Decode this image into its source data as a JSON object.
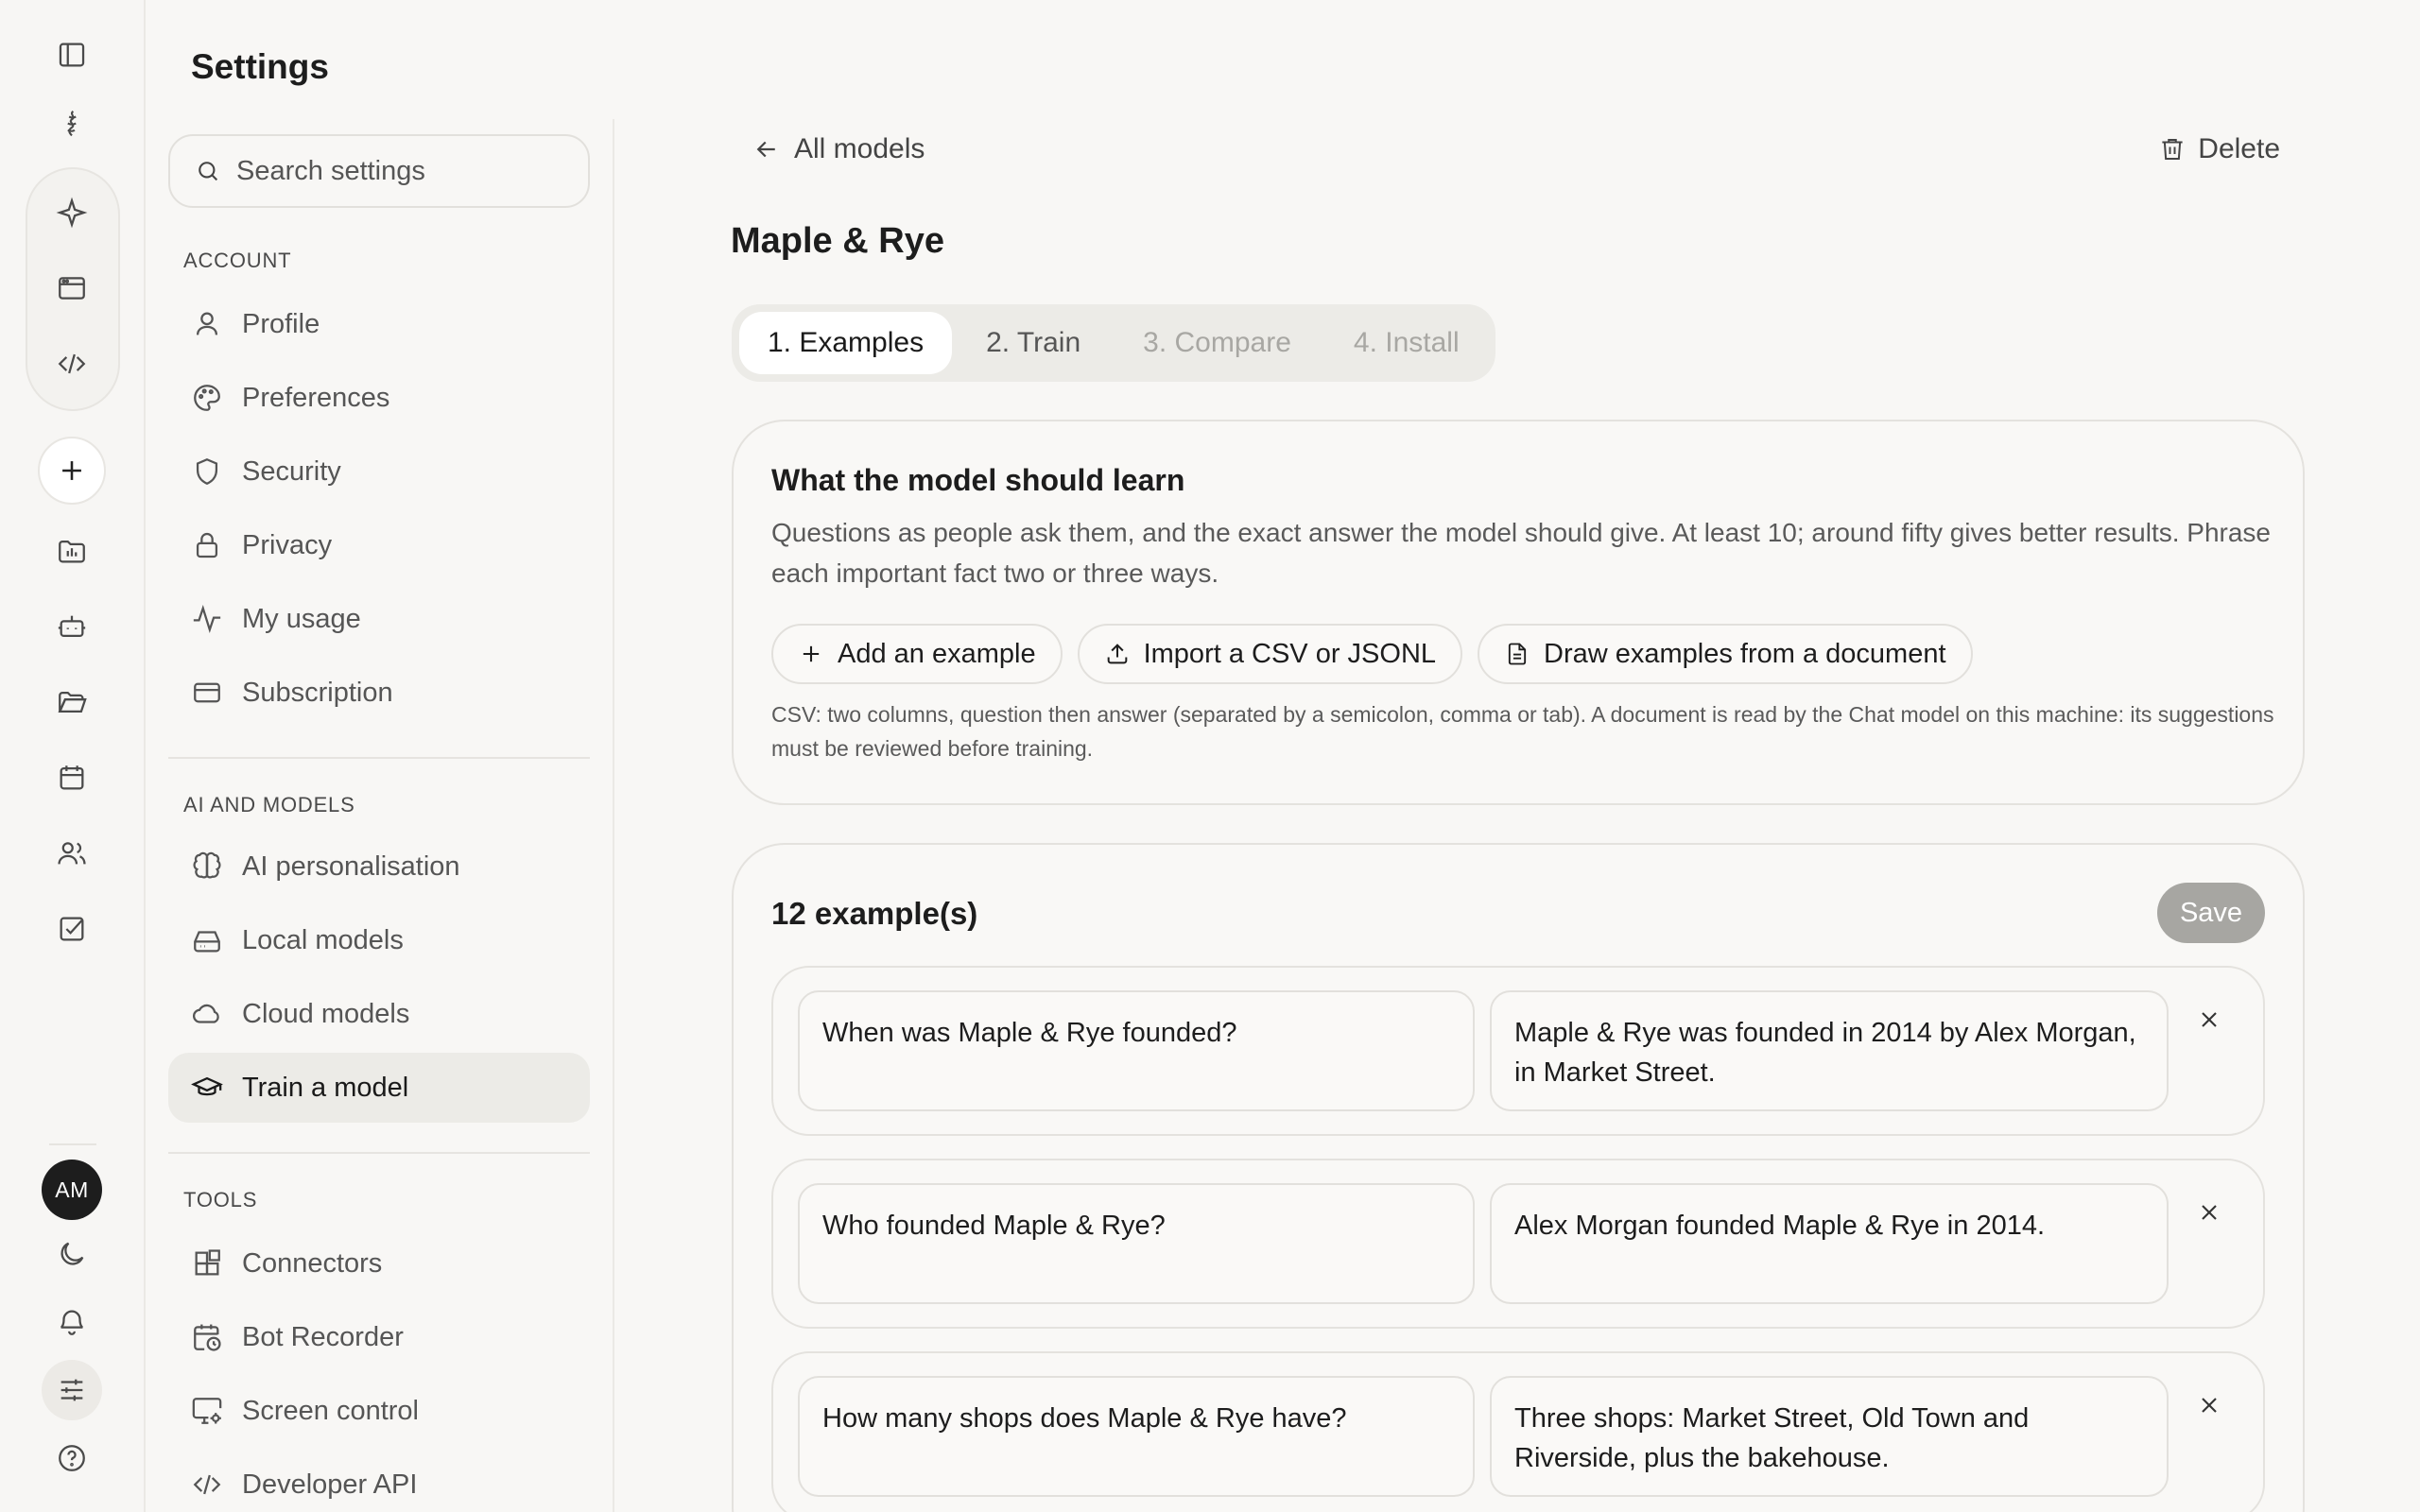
{
  "rail": {
    "avatar_initials": "AM"
  },
  "settings": {
    "title": "Settings",
    "search_placeholder": "Search settings",
    "sections": [
      {
        "label": "ACCOUNT",
        "items": [
          {
            "label": "Profile",
            "icon": "user-icon"
          },
          {
            "label": "Preferences",
            "icon": "palette-icon"
          },
          {
            "label": "Security",
            "icon": "shield-icon"
          },
          {
            "label": "Privacy",
            "icon": "lock-icon"
          },
          {
            "label": "My usage",
            "icon": "activity-icon"
          },
          {
            "label": "Subscription",
            "icon": "credit-card-icon"
          }
        ]
      },
      {
        "label": "AI AND MODELS",
        "items": [
          {
            "label": "AI personalisation",
            "icon": "brain-icon"
          },
          {
            "label": "Local models",
            "icon": "hard-drive-icon"
          },
          {
            "label": "Cloud models",
            "icon": "cloud-icon"
          },
          {
            "label": "Train a model",
            "icon": "graduation-cap-icon",
            "active": true
          }
        ]
      },
      {
        "label": "TOOLS",
        "items": [
          {
            "label": "Connectors",
            "icon": "blocks-icon"
          },
          {
            "label": "Bot Recorder",
            "icon": "calendar-clock-icon"
          },
          {
            "label": "Screen control",
            "icon": "monitor-cog-icon"
          },
          {
            "label": "Developer API",
            "icon": "code-icon"
          }
        ]
      }
    ]
  },
  "main": {
    "back_label": "All models",
    "delete_label": "Delete",
    "model_name": "Maple & Rye",
    "steps": [
      {
        "label": "1. Examples",
        "state": "active"
      },
      {
        "label": "2. Train",
        "state": "enabled"
      },
      {
        "label": "3. Compare",
        "state": "disabled"
      },
      {
        "label": "4. Install",
        "state": "disabled"
      }
    ],
    "learn_card": {
      "title": "What the model should learn",
      "description": "Questions as people ask them, and the exact answer the model should give. At least 10; around fifty gives better results. Phrase each important fact two or three ways.",
      "buttons": [
        "Add an example",
        "Import a CSV or JSONL",
        "Draw examples from a document"
      ],
      "hint": "CSV: two columns, question then answer (separated by a semicolon, comma or tab). A document is read by the Chat model on this machine: its suggestions must be reviewed before training."
    },
    "examples_card": {
      "count_label": "12 example(s)",
      "save_label": "Save",
      "examples": [
        {
          "question": "When was Maple & Rye founded?",
          "answer": "Maple & Rye was founded in 2014 by Alex Morgan, in Market Street."
        },
        {
          "question": "Who founded Maple & Rye?",
          "answer": "Alex Morgan founded Maple & Rye in 2014."
        },
        {
          "question": "How many shops does Maple & Rye have?",
          "answer": "Three shops: Market Street, Old Town and Riverside, plus the bakehouse."
        }
      ]
    }
  }
}
